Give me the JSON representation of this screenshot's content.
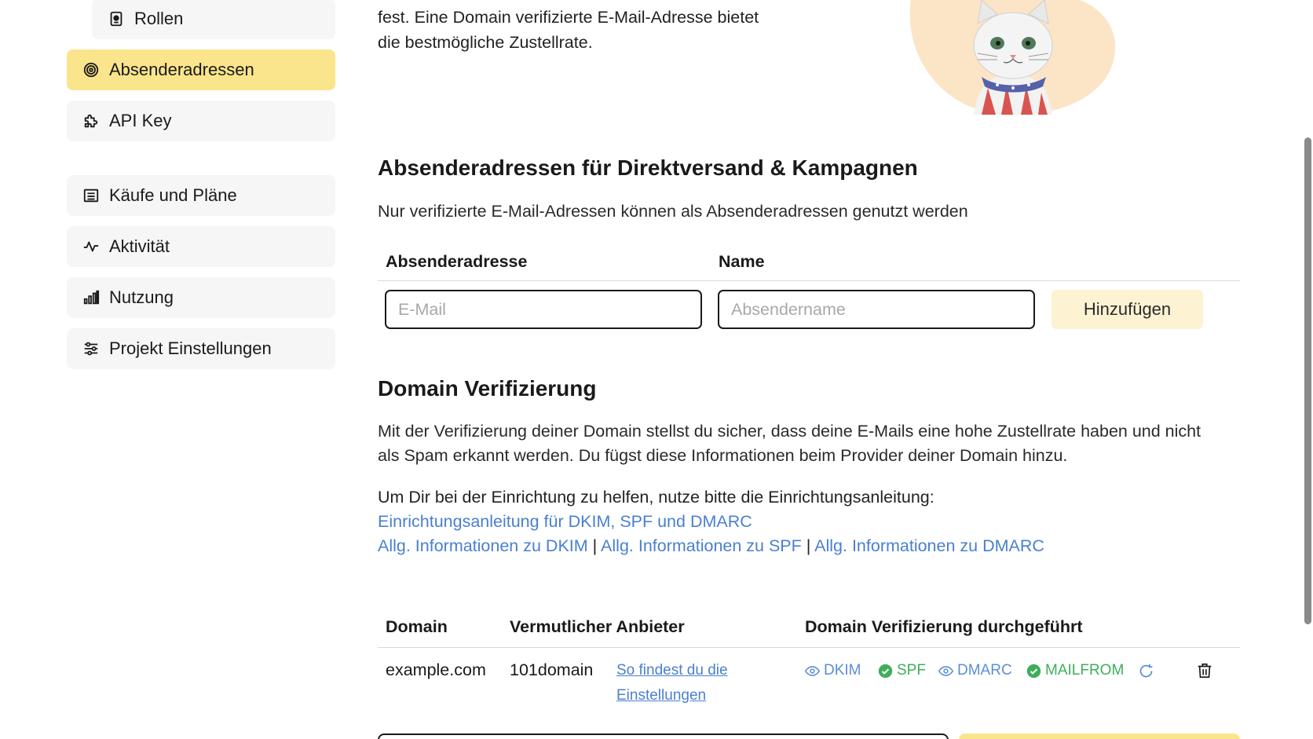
{
  "sidebar": {
    "items": [
      {
        "label": "Rollen",
        "icon": "badge-icon"
      },
      {
        "label": "Absenderadressen",
        "icon": "target-icon",
        "active": true
      },
      {
        "label": "API Key",
        "icon": "puzzle-icon"
      },
      {
        "label": "Käufe und Pläne",
        "icon": "list-icon"
      },
      {
        "label": "Aktivität",
        "icon": "activity-icon"
      },
      {
        "label": "Nutzung",
        "icon": "bar-chart-icon"
      },
      {
        "label": "Projekt Einstellungen",
        "icon": "sliders-icon"
      }
    ]
  },
  "intro": {
    "line1": "fest. Eine Domain verifizierte E-Mail-Adresse bietet",
    "line2": "die bestmögliche Zustellrate."
  },
  "senders": {
    "title": "Absenderadressen für Direktversand & Kampagnen",
    "subtitle": "Nur verifizierte E-Mail-Adressen können als Absenderadressen genutzt werden",
    "col_address": "Absenderadresse",
    "col_name": "Name",
    "email_placeholder": "E-Mail",
    "name_placeholder": "Absendername",
    "add_label": "Hinzufügen"
  },
  "domain": {
    "title": "Domain Verifizierung",
    "desc_line1": "Mit der Verifizierung deiner Domain stellst du sicher, dass deine E-Mails eine hohe Zustellrate haben und nicht",
    "desc_line2": "als Spam erkannt werden. Du fügst diese Informationen beim Provider deiner Domain hinzu.",
    "help_text": "Um Dir bei der Einrichtung zu helfen, nutze bitte die Einrichtungsanleitung:",
    "guide_link": "Einrichtungsanleitung für DKIM, SPF und DMARC",
    "info_dkim": "Allg. Informationen zu DKIM",
    "info_spf": "Allg. Informationen zu SPF",
    "info_dmarc": "Allg. Informationen zu DMARC",
    "separator": "|",
    "table": {
      "col_domain": "Domain",
      "col_provider": "Vermutlicher Anbieter",
      "col_verified": "Domain Verifizierung durchgeführt",
      "rows": [
        {
          "domain": "example.com",
          "provider": "101domain",
          "settings_link_1": "So findest du die",
          "settings_link_2": "Einstellungen",
          "dkim": "DKIM",
          "spf": "SPF",
          "dmarc": "DMARC",
          "mailfrom": "MAILFROM"
        }
      ]
    }
  },
  "colors": {
    "active_bg": "#fbe58c",
    "link": "#4a7fd0",
    "ok": "#3fae5c"
  }
}
